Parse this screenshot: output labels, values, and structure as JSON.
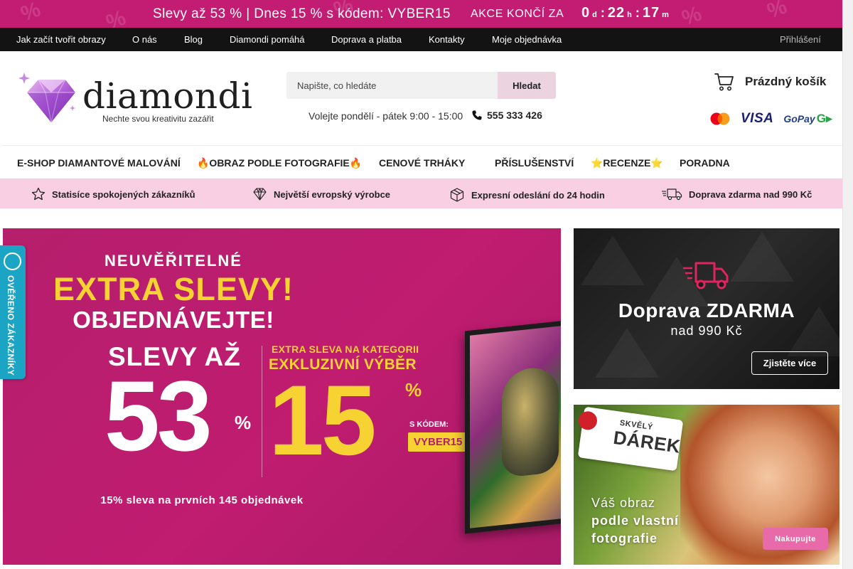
{
  "promo": {
    "text": "Slevy až 53 % | Dnes 15 % s kódem: VYBER15",
    "akce_label": "AKCE KONČÍ ZA",
    "countdown": {
      "days": "0",
      "days_unit": "d",
      "hours": "22",
      "hours_unit": "h",
      "minutes": "17",
      "minutes_unit": "m"
    }
  },
  "topnav": {
    "items": [
      "Jak začít tvořit obrazy",
      "O nás",
      "Blog",
      "Diamondi pomáhá",
      "Doprava a platba",
      "Kontakty",
      "Moje objednávka"
    ],
    "login": "Přihlášení"
  },
  "header": {
    "logo_text": "diamondi",
    "tagline": "Nechte svou kreativitu zazářit",
    "search_placeholder": "Napište, co hledáte",
    "search_button": "Hledat",
    "hours": "Volejte pondělí - pátek 9:00 - 15:00",
    "phone": "555 333 426",
    "cart_label": "Prázdný košík",
    "payments": {
      "visa": "VISA",
      "gopay": "GoPay"
    }
  },
  "catnav": {
    "items": [
      "E-SHOP DIAMANTOVÉ MALOVÁNÍ",
      "🔥OBRAZ PODLE FOTOGRAFIE🔥",
      "CENOVÉ TRHÁKY",
      "PŘÍSLUŠENSTVÍ",
      "⭐RECENZE⭐",
      "PORADNA"
    ]
  },
  "usp": {
    "items": [
      "Statisíce spokojených zákazníků",
      "Největší evropský výrobce",
      "Expresní odeslání do 24 hodin",
      "Doprava zdarma nad 990 Kč"
    ]
  },
  "main_banner": {
    "line1": "NEUVĚŘITELNÉ",
    "line2": "EXTRA SLEVY!",
    "line3": "OBJEDNÁVEJTE!",
    "slevy_az": "SLEVY AŽ",
    "big_left": "53",
    "percent": "%",
    "cat_line1": "EXTRA SLEVA NA KATEGORII",
    "cat_line2": "EXKLUZIVNÍ VÝBĚR",
    "big_right": "15",
    "s_kodem": "S KÓDEM:",
    "code": "VYBER15",
    "footer": "15%  sleva na prvních 145 objednávek"
  },
  "side_banner_1": {
    "title": "Doprava ZDARMA",
    "subtitle": "nad  990 Kč",
    "button": "Zjistěte více"
  },
  "side_banner_2": {
    "tag_small": "SKVĚLÝ",
    "tag_big": "DÁREK",
    "line1": "Váš obraz",
    "line2": "podle vlastní",
    "line3": "fotografie",
    "button": "Nakupujte"
  },
  "verified_badge": {
    "text": "OVĚŘENO ZÁKAZNÍKY"
  },
  "colors": {
    "brand_pink": "#c21d73",
    "dark_nav": "#131313",
    "usp_pink": "#f9d0e3",
    "yellow": "#f6d233",
    "verified_blue": "#1ca4c4"
  }
}
